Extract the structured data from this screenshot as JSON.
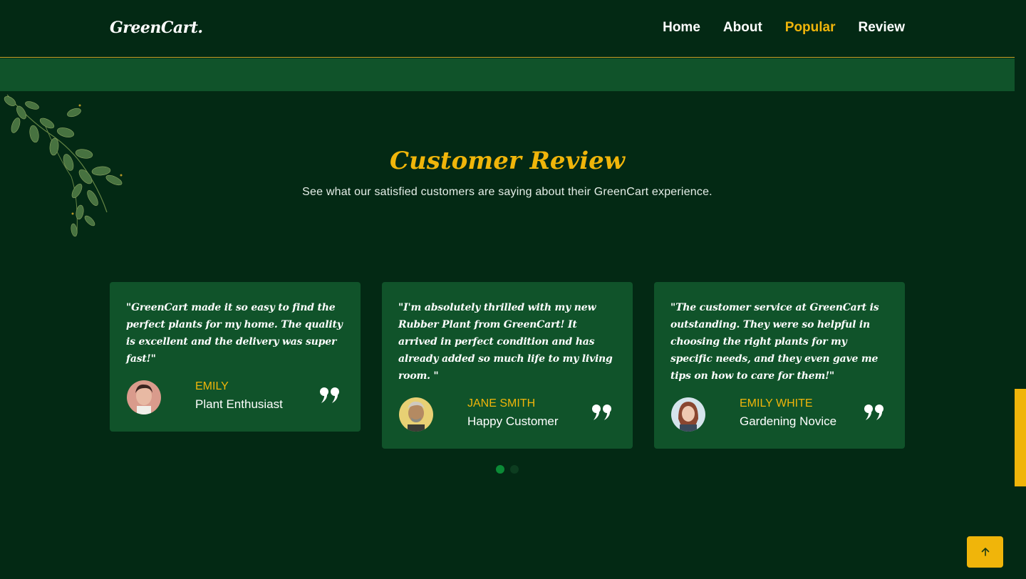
{
  "header": {
    "logo": "GreenCart.",
    "nav": [
      {
        "label": "Home",
        "active": false
      },
      {
        "label": "About",
        "active": false
      },
      {
        "label": "Popular",
        "active": true
      },
      {
        "label": "Review",
        "active": false
      }
    ]
  },
  "section": {
    "title": "Customer Review",
    "subtitle": "See what our satisfied customers are saying about their GreenCart experience."
  },
  "reviews": [
    {
      "quote": "\"GreenCart made it so easy to find the perfect plants for my home. The quality is excellent and the delivery was super fast!\"",
      "name": "EMILY",
      "role": "Plant Enthusiast"
    },
    {
      "quote": "\"I'm absolutely thrilled with my new Rubber Plant from GreenCart! It arrived in perfect condition and has already added so much life to my living room. \"",
      "name": "JANE SMITH",
      "role": "Happy Customer"
    },
    {
      "quote": "\"The customer service at GreenCart is outstanding. They were so helpful in choosing the right plants for my specific needs, and they even gave me tips on how to care for them!\"",
      "name": "EMILY WHITE",
      "role": "Gardening Novice"
    }
  ],
  "pagination": {
    "active_index": 0,
    "count": 2
  },
  "icons": {
    "quote": "quote-icon",
    "to_top": "arrow-up-icon",
    "decor": "leaves-decoration"
  },
  "colors": {
    "background": "#032914",
    "card": "#10532a",
    "accent": "#f0b50a",
    "dot_active": "#0b8a36"
  }
}
